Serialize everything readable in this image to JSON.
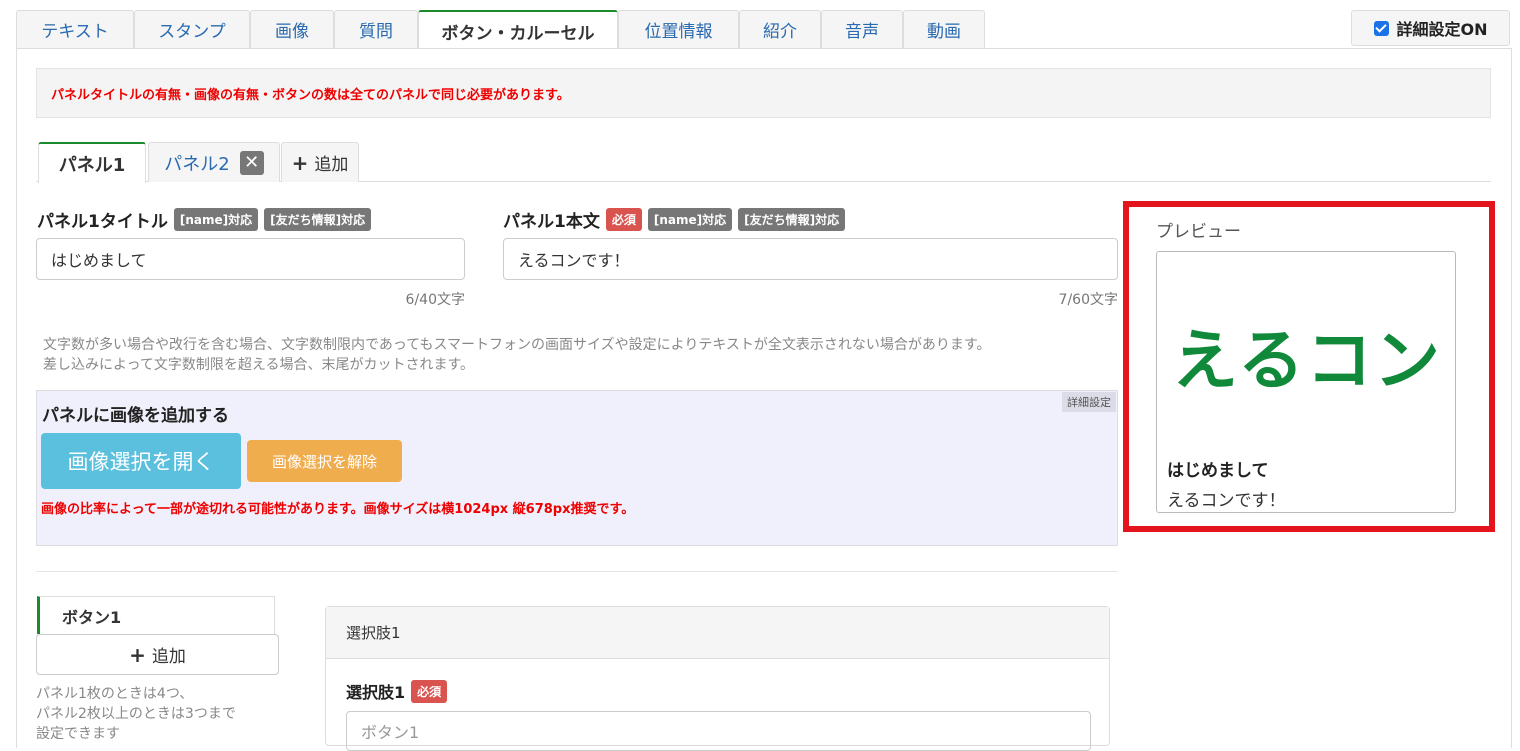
{
  "top_tabs": [
    "テキスト",
    "スタンプ",
    "画像",
    "質問",
    "ボタン・カルーセル",
    "位置情報",
    "紹介",
    "音声",
    "動画"
  ],
  "detail_toggle": "詳細設定ON",
  "warning": "パネルタイトルの有無・画像の有無・ボタンの数は全てのパネルで同じ必要があります。",
  "panel_tabs": {
    "panel1": "パネル1",
    "panel2": "パネル2",
    "add": "追加"
  },
  "title_field": {
    "label": "パネル1タイトル",
    "badge_name": "[name]対応",
    "badge_friend": "[友だち情報]対応",
    "value": "はじめまして",
    "counter": "6/40文字"
  },
  "body_field": {
    "label": "パネル1本文",
    "badge_required": "必須",
    "badge_name": "[name]対応",
    "badge_friend": "[友だち情報]対応",
    "value": "えるコンです！",
    "counter": "7/60文字"
  },
  "help": {
    "line1": "文字数が多い場合や改行を含む場合、文字数制限内であってもスマートフォンの画面サイズや設定によりテキストが全文表示されない場合があります。",
    "line2": "差し込みによって文字数制限を超える場合、末尾がカットされます。"
  },
  "image_section": {
    "title": "パネルに画像を追加する",
    "detail_tag": "詳細設定",
    "open_button": "画像選択を開く",
    "clear_button": "画像選択を解除",
    "note": "画像の比率によって一部が途切れる可能性があります。画像サイズは横1024px 縦678px推奨です。"
  },
  "buttons": {
    "tab": "ボタン1",
    "add": "追加",
    "note_line1": "パネル1枚のときは4つ、",
    "note_line2": "パネル2枚以上のときは3つまで",
    "note_line3": "設定できます"
  },
  "choice": {
    "header": "選択肢1",
    "label": "選択肢1",
    "badge_required": "必須",
    "placeholder": "ボタン1"
  },
  "preview": {
    "label": "プレビュー",
    "logo_text": "えるコン",
    "title": "はじめまして",
    "body": "えるコンです！"
  },
  "colors": {
    "accent_green": "#1a8a2a",
    "link_blue": "#2a6ab0",
    "warning_red": "#ee0000",
    "highlight_red": "#e3141b",
    "logo_green": "#10893a"
  }
}
